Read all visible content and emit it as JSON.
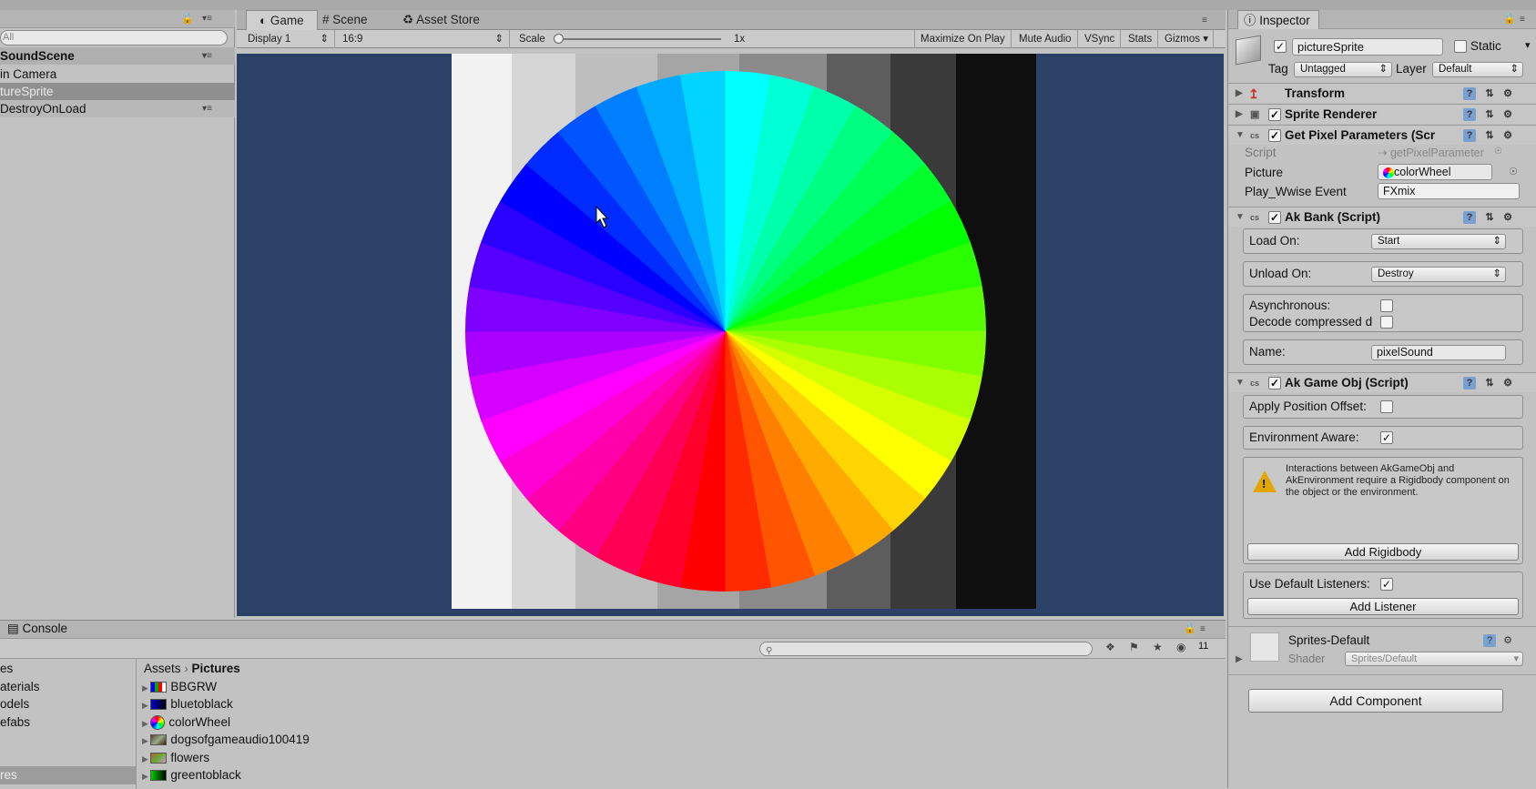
{
  "hierarchy": {
    "search_placeholder": "All",
    "scene_name": "SoundScene",
    "items": [
      "in Camera",
      "tureSprite"
    ],
    "dont_destroy": "DestroyOnLoad"
  },
  "game": {
    "tabs": [
      "Game",
      "Scene",
      "Asset Store"
    ],
    "display": "Display 1",
    "aspect": "16:9",
    "scale_label": "Scale",
    "scale_value": "1x",
    "buttons": [
      "Maximize On Play",
      "Mute Audio",
      "VSync",
      "Stats",
      "Gizmos"
    ]
  },
  "inspector": {
    "title": "Inspector",
    "object_name": "pictureSprite",
    "static_label": "Static",
    "tag_label": "Tag",
    "tag_value": "Untagged",
    "layer_label": "Layer",
    "layer_value": "Default",
    "components": {
      "transform": "Transform",
      "sprite_renderer": "Sprite Renderer",
      "get_pixel": "Get Pixel Parameters (Scr",
      "ak_bank": "Ak Bank (Script)",
      "ak_game_obj": "Ak Game Obj (Script)"
    },
    "script_label": "Script",
    "script_value": "getPixelParameter",
    "picture_label": "Picture",
    "picture_value": "colorWheel",
    "wwise_label": "Play_Wwise Event",
    "wwise_value": "FXmix",
    "load_on_label": "Load On:",
    "load_on_value": "Start",
    "unload_on_label": "Unload On:",
    "unload_on_value": "Destroy",
    "async_label": "Asynchronous:",
    "decode_label": "Decode compressed d",
    "name_label": "Name:",
    "name_value": "pixelSound",
    "apply_offset_label": "Apply Position Offset:",
    "env_aware_label": "Environment Aware:",
    "warning_text": "Interactions between AkGameObj and AkEnvironment require a Rigidbody component on the object or the environment.",
    "add_rigidbody": "Add Rigidbody",
    "default_listeners_label": "Use Default Listeners:",
    "add_listener": "Add Listener",
    "material_name": "Sprites-Default",
    "shader_label": "Shader",
    "shader_value": "Sprites/Default",
    "add_component": "Add Component"
  },
  "bottom": {
    "console_tab": "Console",
    "hidden_count": "11",
    "folders": [
      "es",
      "aterials",
      "odels",
      "efabs",
      "res"
    ],
    "breadcrumb": [
      "Assets",
      "Pictures"
    ],
    "assets": [
      "BBGRW",
      "bluetoblack",
      "colorWheel",
      "dogsofgameaudio100419",
      "flowers",
      "greentoblack"
    ]
  },
  "colors": {
    "viewport_bg": "#2c4167",
    "panel_bg": "#c2c2c2",
    "warning": "#e2a600"
  }
}
